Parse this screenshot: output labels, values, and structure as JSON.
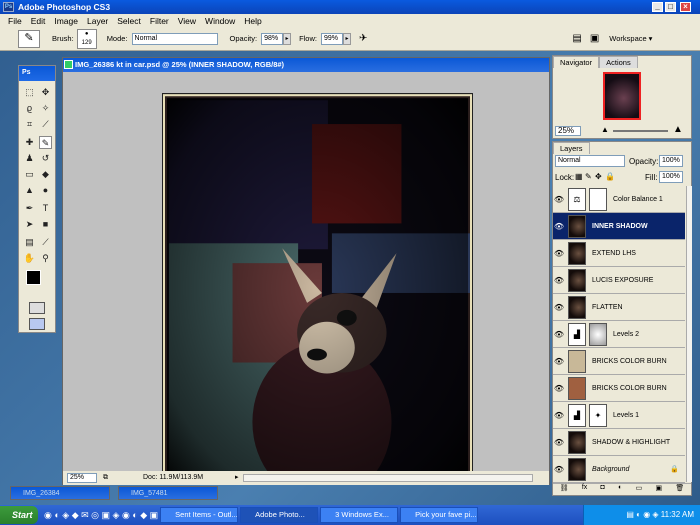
{
  "app": {
    "title": "Adobe Photoshop CS3"
  },
  "menu": [
    "File",
    "Edit",
    "Image",
    "Layer",
    "Select",
    "Filter",
    "View",
    "Window",
    "Help"
  ],
  "options": {
    "brush_label": "Brush:",
    "brush_size": "129",
    "mode_label": "Mode:",
    "mode_value": "Normal",
    "opacity_label": "Opacity:",
    "opacity_value": "98%",
    "flow_label": "Flow:",
    "flow_value": "99%",
    "workspace": "Workspace"
  },
  "toolbox": {
    "header": "Ps"
  },
  "document": {
    "title": "IMG_26386 kt in car.psd @ 25% (INNER SHADOW, RGB/8#)",
    "zoom": "25%",
    "doc_size": "Doc: 11.9M/113.9M"
  },
  "minimized": [
    "IMG_26384",
    "IMG_57481"
  ],
  "navigator": {
    "tabs": [
      "Navigator",
      "Actions"
    ],
    "zoom": "25%"
  },
  "layers": {
    "tab": "Layers",
    "blend_mode": "Normal",
    "opacity_label": "Opacity:",
    "opacity": "100%",
    "lock_label": "Lock:",
    "fill_label": "Fill:",
    "fill": "100%",
    "items": [
      {
        "name": "Color Balance 1"
      },
      {
        "name": "INNER SHADOW"
      },
      {
        "name": "EXTEND LHS"
      },
      {
        "name": "LUCIS EXPOSURE"
      },
      {
        "name": "FLATTEN"
      },
      {
        "name": "Levels 2"
      },
      {
        "name": "BRICKS COLOR BURN"
      },
      {
        "name": "BRICKS COLOR BURN"
      },
      {
        "name": "Levels 1"
      },
      {
        "name": "SHADOW & HIGHLIGHT"
      },
      {
        "name": "Background"
      }
    ]
  },
  "taskbar": {
    "start": "Start",
    "tasks": [
      "Sent Items - Outl...",
      "Adobe Photo...",
      "3 Windows Ex...",
      "Pick your fave pi..."
    ],
    "clock": "11:32 AM"
  },
  "colors": {
    "selection": "#0a246a",
    "title": "#0b58d6"
  }
}
